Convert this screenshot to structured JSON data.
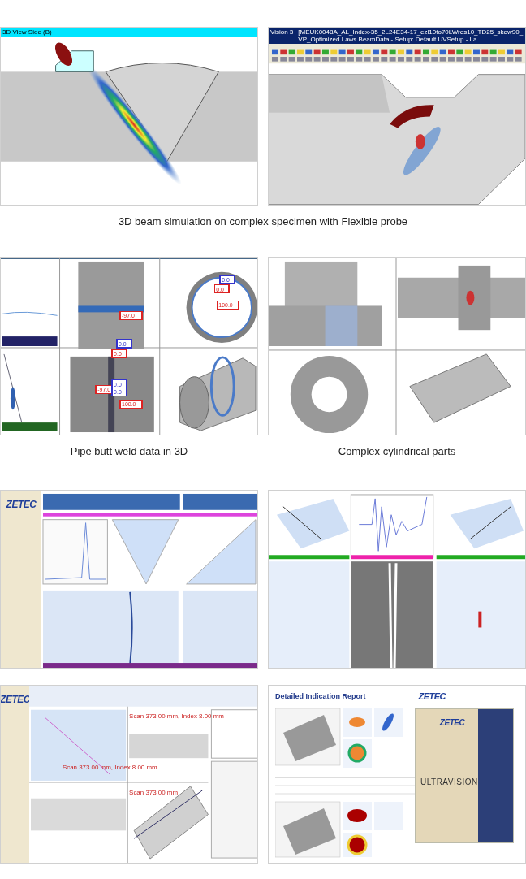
{
  "rows": [
    {
      "caption": "3D beam simulation on complex specimen with Flexible probe",
      "panels": [
        {
          "kind": "beam-side",
          "title": "3D View Side (B)"
        },
        {
          "kind": "beam-3d",
          "app_name": "Vision 3",
          "title": "[MEUK0048A_AL_Index-35_2L24E34-17_ezl10to70LWres10_TD25_skew90_VP_Optimized Laws.BeamData - Setup: Default.UVSetup - La"
        }
      ]
    },
    {
      "panels": [
        {
          "kind": "pipe-weld",
          "caption": "Pipe butt weld data in 3D",
          "labels": [
            {
              "text": "-97.0",
              "color": "#dd2222"
            },
            {
              "text": "0.0",
              "color": "#3333cc"
            },
            {
              "text": "0.0",
              "color": "#dd2222"
            },
            {
              "text": "0.0",
              "color": "#3333cc"
            },
            {
              "text": "0.0",
              "color": "#dd2222"
            },
            {
              "text": "100.0",
              "color": "#dd2222"
            },
            {
              "text": "-97.0",
              "color": "#dd2222"
            },
            {
              "text": "0.0",
              "color": "#3333cc"
            },
            {
              "text": "0.0",
              "color": "#3333cc"
            },
            {
              "text": "100.0",
              "color": "#dd2222"
            }
          ]
        },
        {
          "kind": "cylinder",
          "caption": "Complex cylindrical parts"
        }
      ]
    },
    {
      "panels": [
        {
          "kind": "zetec-analysis",
          "logo": "ZETEC"
        },
        {
          "kind": "scans"
        }
      ]
    },
    {
      "panels": [
        {
          "kind": "zetec-3d",
          "logo": "ZETEC",
          "labels": [
            "Scan 373.00 mm, Index 8.00 mm",
            "Scan 373.00 mm, Index 8.00 mm",
            "Scan 373.00 mm"
          ]
        },
        {
          "kind": "report",
          "title": "Detailed Indication Report",
          "logo": "ZETEC",
          "box_logo": "ZETEC",
          "box_title": "ULTRAVISION"
        }
      ]
    }
  ]
}
